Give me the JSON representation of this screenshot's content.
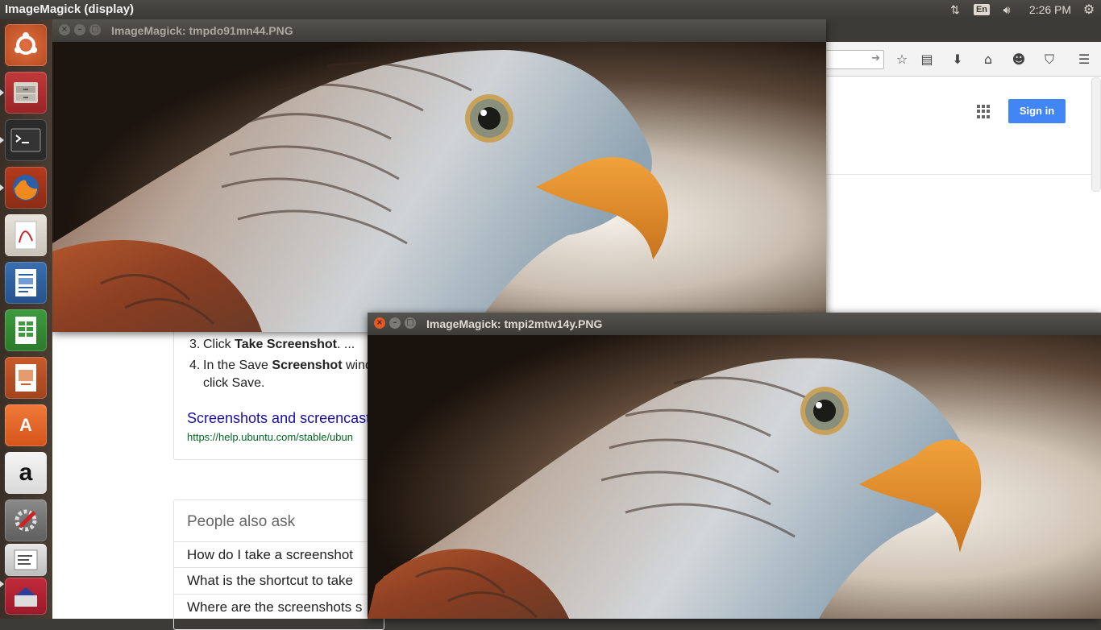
{
  "top_panel": {
    "app_title": "ImageMagick (display)",
    "keyboard_layout": "En",
    "clock": "2:26 PM",
    "icons": [
      "network-icon",
      "keyboard-indicator",
      "volume-icon",
      "settings-icon"
    ]
  },
  "launcher": {
    "items": [
      {
        "name": "ubuntu-dash",
        "icon": "ubuntu-logo-icon"
      },
      {
        "name": "files",
        "icon": "file-cabinet-icon"
      },
      {
        "name": "terminal",
        "icon": "terminal-icon"
      },
      {
        "name": "firefox",
        "icon": "firefox-icon"
      },
      {
        "name": "document-viewer",
        "icon": "pdf-viewer-icon"
      },
      {
        "name": "libreoffice-writer",
        "icon": "writer-icon"
      },
      {
        "name": "libreoffice-calc",
        "icon": "calc-icon"
      },
      {
        "name": "libreoffice-impress",
        "icon": "impress-icon"
      },
      {
        "name": "software-center",
        "icon": "shopping-bag-icon"
      },
      {
        "name": "amazon",
        "icon": "amazon-icon"
      },
      {
        "name": "system-settings",
        "icon": "wrench-gear-icon"
      },
      {
        "name": "text-editor",
        "icon": "text-editor-icon"
      },
      {
        "name": "imagemagick",
        "icon": "imagemagick-icon"
      }
    ]
  },
  "windows": {
    "back": {
      "title": "ImageMagick: tmpdo91mn44.PNG"
    },
    "front": {
      "title": "ImageMagick: tmpi2mtw14y.PNG"
    }
  },
  "browser": {
    "sign_in": "Sign in",
    "toolbar_icons": [
      "bookmark-star-icon",
      "reading-list-icon",
      "download-icon",
      "home-icon",
      "hello-icon",
      "pocket-icon",
      "menu-icon"
    ]
  },
  "serp": {
    "steps": [
      {
        "num": "3.",
        "pre": "Click ",
        "bold": "Take Screenshot",
        "post": ". ..."
      },
      {
        "num": "4.",
        "pre": "In the Save ",
        "bold": "Screenshot",
        "post": " wind"
      }
    ],
    "step4_line2": "click Save.",
    "result_link": "Screenshots and screencast",
    "result_url": "https://help.ubuntu.com/stable/ubun",
    "paa_title": "People also ask",
    "paa_questions": [
      "How do I take a screenshot",
      "What is the shortcut to take",
      "Where are the screenshots s"
    ]
  }
}
